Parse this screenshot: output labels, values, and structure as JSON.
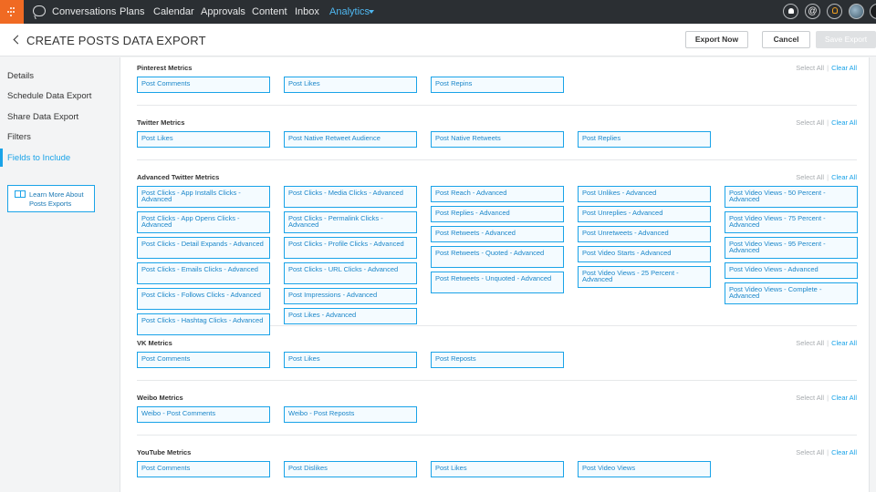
{
  "topbar": {
    "nav": [
      "Conversations",
      "Plans",
      "Calendar",
      "Approvals",
      "Content",
      "Inbox",
      "Analytics"
    ],
    "active": "Analytics",
    "icons": [
      "bell-icon",
      "at-icon",
      "lightbulb-icon",
      "avatar",
      "avatar"
    ]
  },
  "header": {
    "title": "CREATE POSTS DATA EXPORT",
    "export_now": "Export Now",
    "cancel": "Cancel",
    "save_export": "Save Export"
  },
  "sidebar": {
    "items": [
      "Details",
      "Schedule Data Export",
      "Share Data Export",
      "Filters",
      "Fields to Include"
    ],
    "active_index": 4,
    "learn_more": "Learn More About Posts Exports"
  },
  "actions": {
    "select_all": "Select All",
    "separator": "|",
    "clear_all": "Clear All"
  },
  "colors": {
    "accent": "#1aa3e8",
    "brand": "#f06a23",
    "nav_bg": "#2b2f33"
  },
  "sections": [
    {
      "title": "Pinterest Metrics",
      "columns": [
        [
          "Post Comments"
        ],
        [
          "Post Likes"
        ],
        [
          "Post Repins"
        ]
      ]
    },
    {
      "title": "Twitter Metrics",
      "columns": [
        [
          "Post Likes"
        ],
        [
          "Post Native Retweet Audience"
        ],
        [
          "Post Native Retweets"
        ],
        [
          "Post Replies"
        ]
      ]
    },
    {
      "title": "Advanced Twitter Metrics",
      "columns": [
        [
          "Post Clicks - App Installs Clicks - Advanced",
          "Post Clicks - App Opens Clicks - Advanced",
          "Post Clicks - Detail Expands - Advanced",
          "Post Clicks - Emails Clicks - Advanced",
          "Post Clicks - Follows Clicks - Advanced",
          "Post Clicks - Hashtag Clicks - Advanced"
        ],
        [
          "Post Clicks - Media Clicks - Advanced",
          "Post Clicks - Permalink Clicks - Advanced",
          "Post Clicks - Profile Clicks - Advanced",
          "Post Clicks - URL Clicks - Advanced",
          "Post Impressions - Advanced",
          "Post Likes - Advanced"
        ],
        [
          "Post Reach - Advanced",
          "Post Replies - Advanced",
          "Post Retweets - Advanced",
          "Post Retweets - Quoted - Advanced",
          "Post Retweets - Unquoted - Advanced"
        ],
        [
          "Post Unlikes - Advanced",
          "Post Unreplies - Advanced",
          "Post Unretweets - Advanced",
          "Post Video Starts - Advanced",
          "Post Video Views - 25 Percent - Advanced"
        ],
        [
          "Post Video Views - 50 Percent - Advanced",
          "Post Video Views - 75 Percent - Advanced",
          "Post Video Views - 95 Percent - Advanced",
          "Post Video Views - Advanced",
          "Post Video Views - Complete - Advanced"
        ]
      ]
    },
    {
      "title": "VK Metrics",
      "columns": [
        [
          "Post Comments"
        ],
        [
          "Post Likes"
        ],
        [
          "Post Reposts"
        ]
      ]
    },
    {
      "title": "Weibo Metrics",
      "columns": [
        [
          "Weibo - Post Comments"
        ],
        [
          "Weibo - Post Reposts"
        ]
      ]
    },
    {
      "title": "YouTube Metrics",
      "columns": [
        [
          "Post Comments"
        ],
        [
          "Post Dislikes"
        ],
        [
          "Post Likes"
        ],
        [
          "Post Video Views"
        ]
      ]
    }
  ]
}
